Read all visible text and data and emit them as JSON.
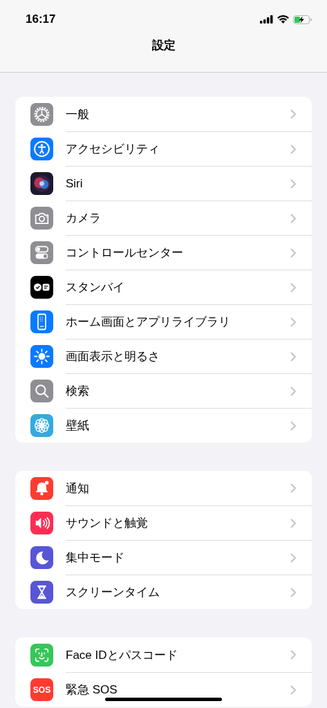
{
  "status_bar": {
    "time": "16:17"
  },
  "nav": {
    "title": "設定"
  },
  "groups": [
    {
      "rows": [
        {
          "label": "一般",
          "kind": "gear",
          "color": "#8e8e93"
        },
        {
          "label": "アクセシビリティ",
          "kind": "accessibility",
          "color": "#0a7aff"
        },
        {
          "label": "Siri",
          "kind": "siri",
          "color": "#1d1a2e"
        },
        {
          "label": "カメラ",
          "kind": "camera",
          "color": "#8e8e93"
        },
        {
          "label": "コントロールセンター",
          "kind": "toggles",
          "color": "#8e8e93"
        },
        {
          "label": "スタンバイ",
          "kind": "standby",
          "color": "#000000"
        },
        {
          "label": "ホーム画面とアプリライブラリ",
          "kind": "homescreen",
          "color": "#0a7aff"
        },
        {
          "label": "画面表示と明るさ",
          "kind": "brightness",
          "color": "#0a7aff"
        },
        {
          "label": "検索",
          "kind": "search",
          "color": "#8e8e93"
        },
        {
          "label": "壁紙",
          "kind": "flower",
          "color": "#35aadc"
        }
      ]
    },
    {
      "rows": [
        {
          "label": "通知",
          "kind": "bell",
          "color": "#ff3b30"
        },
        {
          "label": "サウンドと触覚",
          "kind": "speaker",
          "color": "#ff2d55"
        },
        {
          "label": "集中モード",
          "kind": "moon",
          "color": "#5856d6"
        },
        {
          "label": "スクリーンタイム",
          "kind": "hourglass",
          "color": "#5856d6"
        }
      ]
    },
    {
      "rows": [
        {
          "label": "Face IDとパスコード",
          "kind": "faceid",
          "color": "#34c759"
        },
        {
          "label": "緊急 SOS",
          "kind": "sos",
          "color": "#ff3b30",
          "icon_text": "SOS"
        }
      ]
    }
  ]
}
